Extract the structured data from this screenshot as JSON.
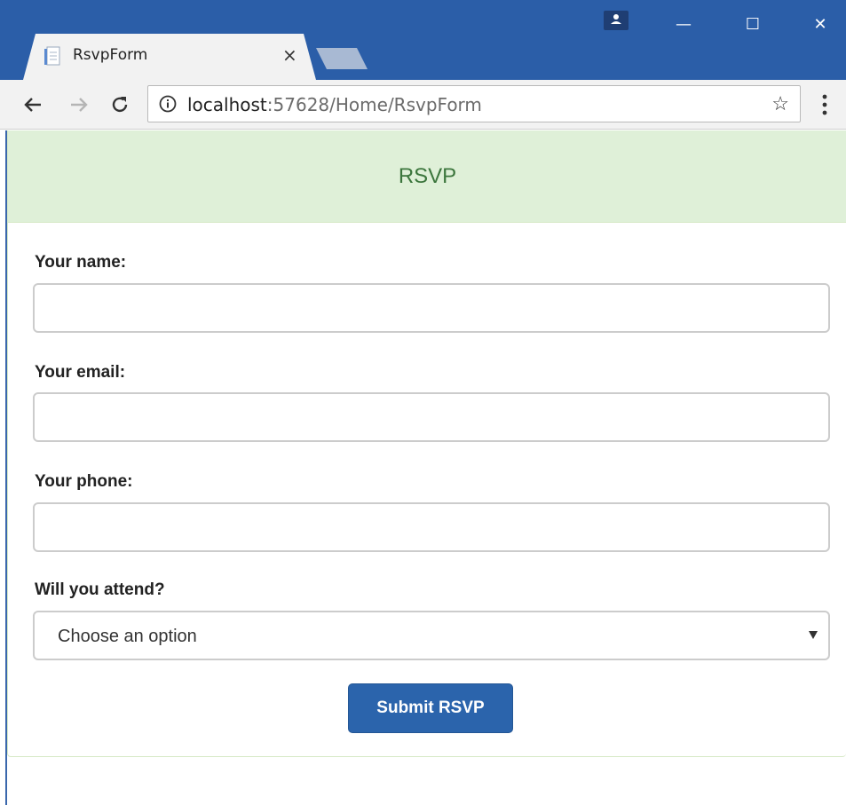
{
  "browser": {
    "tab": {
      "title": "RsvpForm",
      "close_glyph": "×"
    },
    "window_controls": {
      "minimize": "—",
      "maximize": "☐",
      "close": "✕"
    },
    "address": {
      "host": "localhost",
      "rest": ":57628/Home/RsvpForm"
    },
    "icons": {
      "favicon": "page-icon",
      "back": "back-arrow-icon",
      "forward": "forward-arrow-icon",
      "reload": "reload-icon",
      "info": "info-icon",
      "star": "star-icon",
      "menu": "kebab-menu-icon",
      "profile": "profile-icon"
    },
    "colors": {
      "titlebar": "#2b5ea8",
      "toolbar": "#f2f2f2"
    }
  },
  "page": {
    "heading": "RSVP",
    "fields": {
      "name_label": "Your name:",
      "name_value": "",
      "email_label": "Your email:",
      "email_value": "",
      "phone_label": "Your phone:",
      "phone_value": "",
      "attend_label": "Will you attend?",
      "attend_selected": "Choose an option"
    },
    "submit_label": "Submit RSVP",
    "colors": {
      "heading_bg": "#dff0d8",
      "heading_text": "#3c763d",
      "button_bg": "#2b64ac"
    }
  }
}
